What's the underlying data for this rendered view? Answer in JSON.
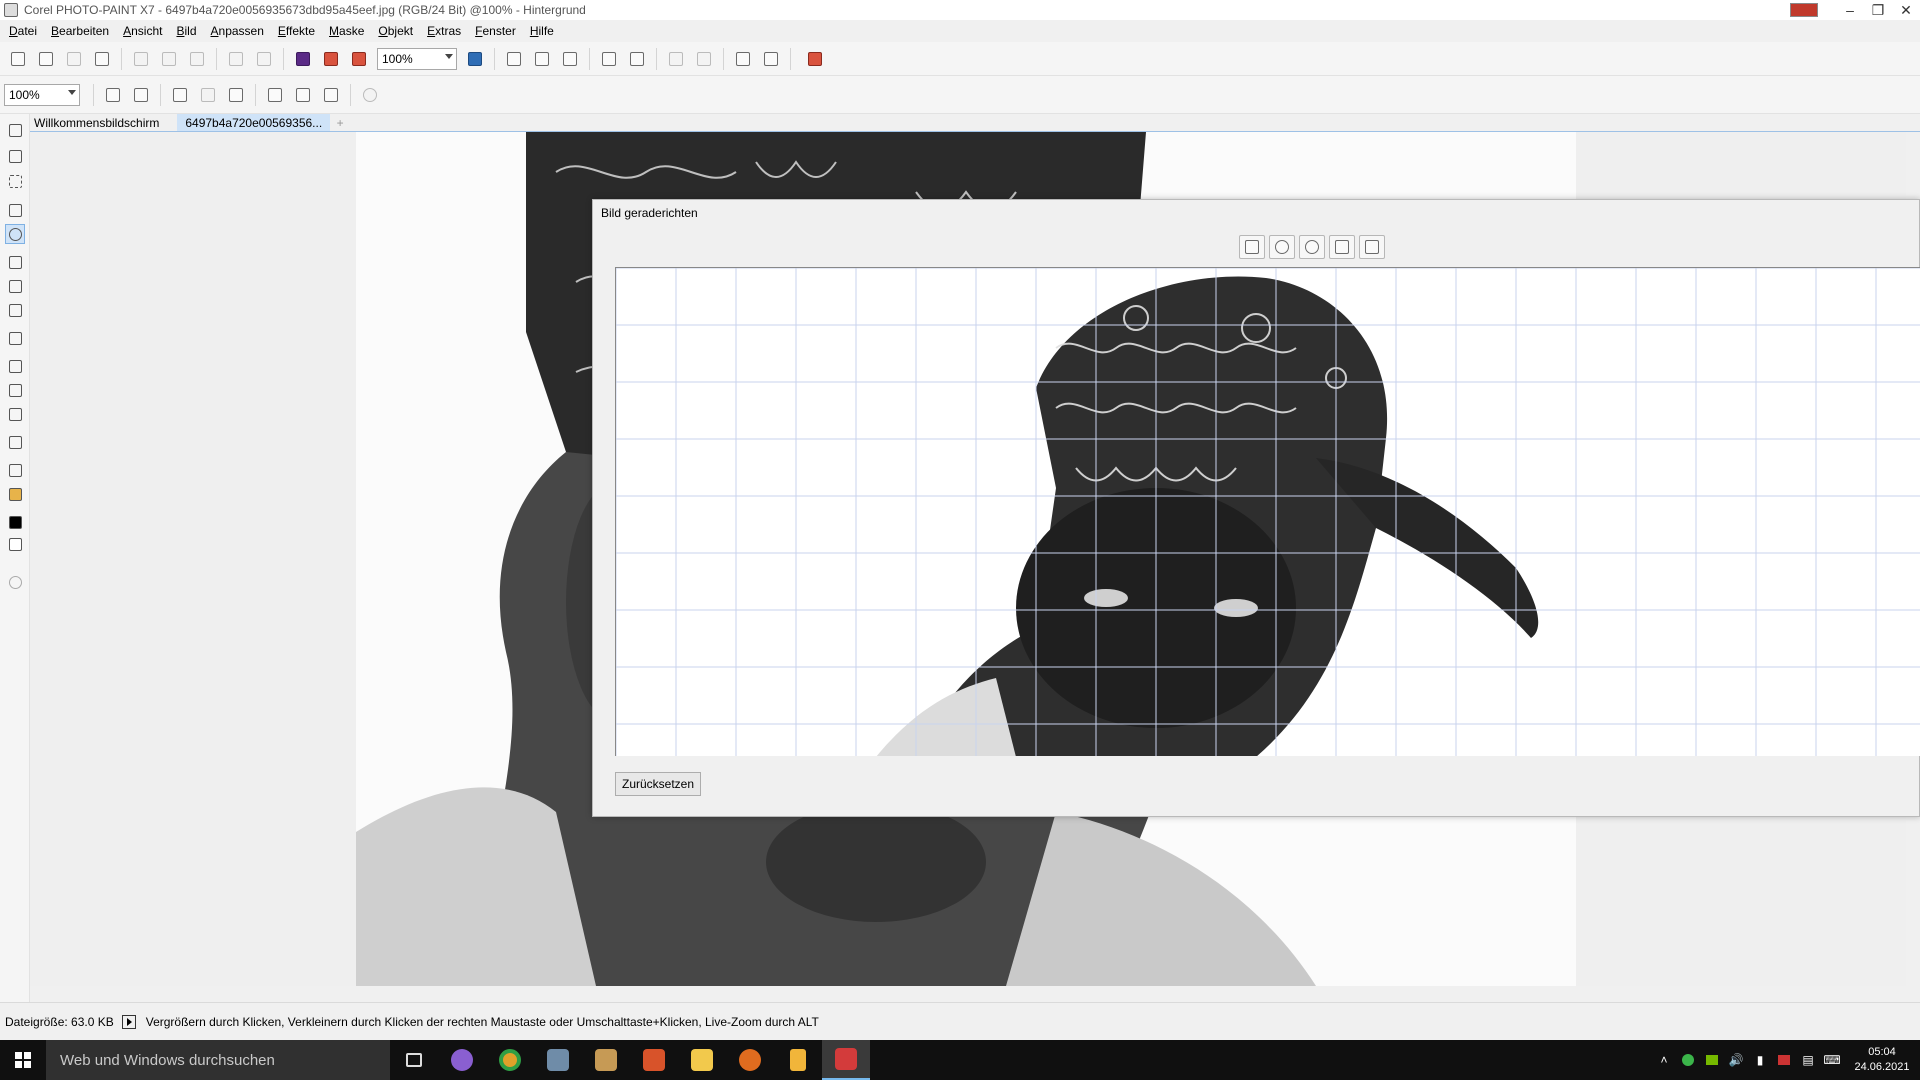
{
  "window": {
    "title": "Corel PHOTO-PAINT X7 - 6497b4a720e0056935673dbd95a45eef.jpg (RGB/24 Bit) @100% - Hintergrund",
    "minimize_glyph": "–",
    "maximize_glyph": "❐",
    "close_glyph": "✕"
  },
  "menu": [
    "Datei",
    "Bearbeiten",
    "Ansicht",
    "Bild",
    "Anpassen",
    "Effekte",
    "Maske",
    "Objekt",
    "Extras",
    "Fenster",
    "Hilfe"
  ],
  "toolbar": {
    "zoom_value": "100%"
  },
  "toolbar2": {
    "zoom_value": "100%"
  },
  "tabs": [
    {
      "label": "Willkommensbildschirm"
    },
    {
      "label": "6497b4a720e00569356..."
    }
  ],
  "tab_add_glyph": "+",
  "dialog": {
    "title": "Bild geraderichten",
    "reset_label": "Zurücksetzen"
  },
  "status": {
    "file_size": "Dateigröße: 63.0 KB",
    "hint": "Vergrößern durch Klicken, Verkleinern durch Klicken der rechten Maustaste oder Umschalttaste+Klicken, Live-Zoom durch ALT"
  },
  "taskbar": {
    "search_placeholder": "Web und Windows durchsuchen",
    "time": "05:04",
    "date": "24.06.2021"
  },
  "colors": {
    "grid_line": "#c9d3ee",
    "tab_active": "#cfe3f8",
    "taskbar": "#101010"
  }
}
